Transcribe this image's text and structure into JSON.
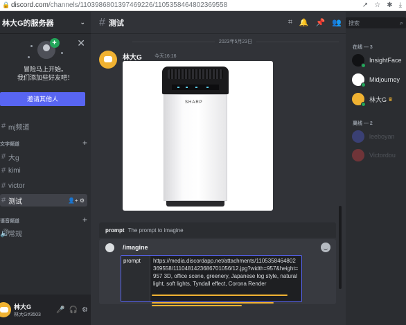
{
  "browser": {
    "url_host": "discord.com",
    "url_path": "/channels/1103986801397469226/1105358464802369558"
  },
  "server": {
    "name": "林大G的服务器",
    "invite": {
      "line1": "冒险马上开始。",
      "line2": "我们添加些好友吧！",
      "button": "邀请其他人"
    },
    "channels_top": [
      {
        "label": "mj频道"
      }
    ],
    "text_category": "文字频道",
    "text_channels": [
      {
        "label": "大g"
      },
      {
        "label": "kimi"
      },
      {
        "label": "victor"
      },
      {
        "label": "测试",
        "active": true
      }
    ],
    "voice_category": "语音频道",
    "voice_channels": [
      {
        "label": "常规"
      }
    ]
  },
  "user": {
    "name": "林大G",
    "tag": "林大G#3503"
  },
  "chat": {
    "channel_name": "测试",
    "date_divider": "2023年5月23日",
    "message": {
      "author": "林大G",
      "time": "今天16:16",
      "image_brand": "SHARP"
    },
    "command_hint": {
      "command": "prompt",
      "description": "The prompt to imagine"
    },
    "composer": {
      "command": "/imagine",
      "option_label": "prompt",
      "option_value": "https://media.discordapp.net/attachments/1105358464802369558/1110481423686701056/12.jpg?width=957&height=957 3D, office scene, greenery, Japanese log style, natural light, soft lights, Tyndall effect, Corona Render"
    }
  },
  "members": {
    "search_placeholder": "搜索",
    "online_header": "在线 — 3",
    "offline_header": "离线 — 2",
    "online": [
      {
        "name": "InsightFace",
        "avatar_color": "#111214"
      },
      {
        "name": "Midjourney",
        "avatar_color": "#ffffff"
      },
      {
        "name": "林大G",
        "avatar_color": "#f0b232",
        "owner": true
      }
    ],
    "offline": [
      {
        "name": "leeboyan",
        "avatar_color": "#5865f2"
      },
      {
        "name": "Victordou",
        "avatar_color": "#ed4245"
      }
    ]
  }
}
